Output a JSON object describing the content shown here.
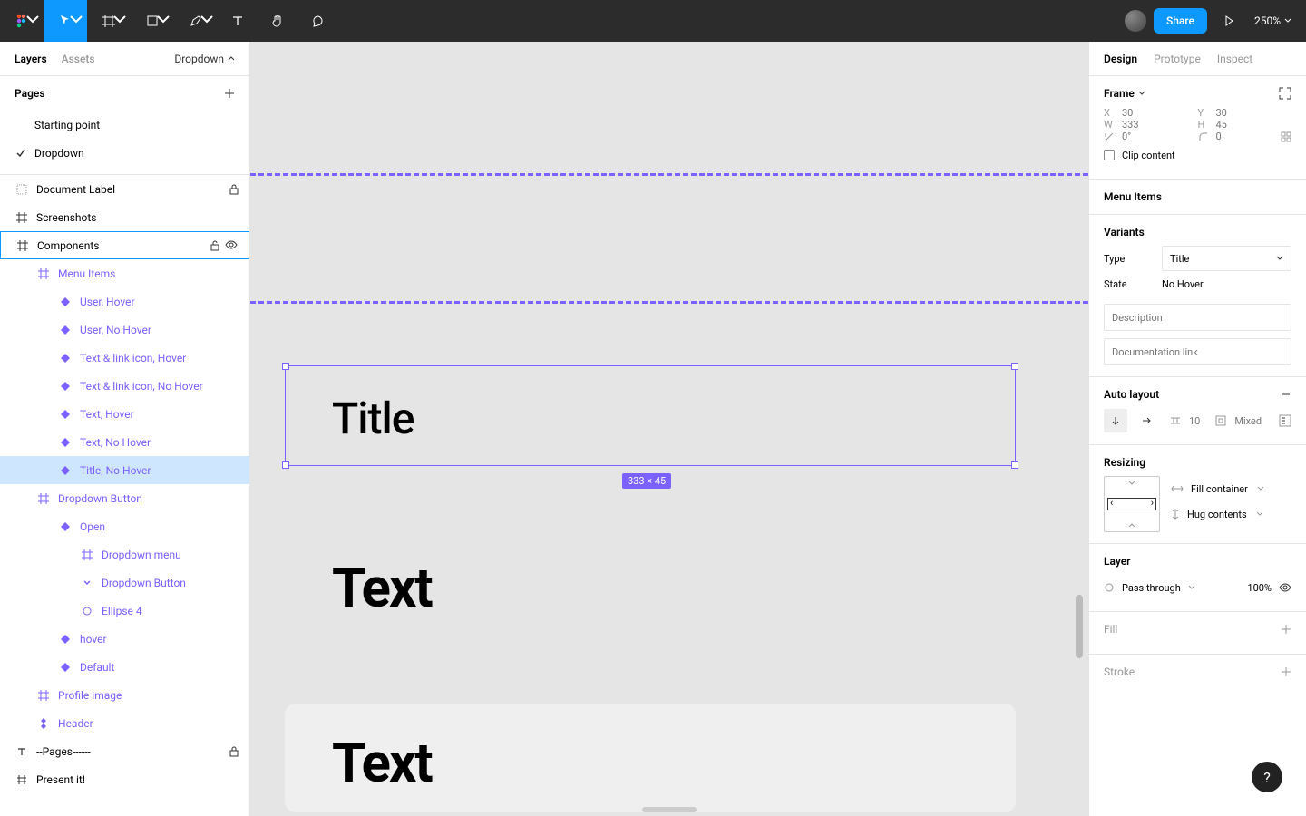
{
  "toolbar": {
    "share_label": "Share",
    "zoom": "250%"
  },
  "left_panel": {
    "tabs": {
      "layers": "Layers",
      "assets": "Assets"
    },
    "page_dropdown": "Dropdown",
    "pages_header": "Pages",
    "pages": [
      {
        "name": "Starting point",
        "current": false
      },
      {
        "name": "Dropdown",
        "current": true
      }
    ],
    "tree": [
      {
        "label": "Document Label",
        "indent": 0,
        "icon": "dotted-frame",
        "locked": true
      },
      {
        "label": "Screenshots",
        "indent": 0,
        "icon": "frame"
      },
      {
        "label": "Components",
        "indent": 0,
        "icon": "frame",
        "selected_parent": true,
        "unlocked": true,
        "visible": true
      },
      {
        "label": "Menu Items",
        "indent": 1,
        "icon": "frame",
        "comp": true
      },
      {
        "label": "User, Hover",
        "indent": 2,
        "icon": "diamond",
        "comp": true
      },
      {
        "label": "User, No Hover",
        "indent": 2,
        "icon": "diamond",
        "comp": true
      },
      {
        "label": "Text & link icon, Hover",
        "indent": 2,
        "icon": "diamond",
        "comp": true
      },
      {
        "label": "Text & link icon, No Hover",
        "indent": 2,
        "icon": "diamond",
        "comp": true
      },
      {
        "label": "Text, Hover",
        "indent": 2,
        "icon": "diamond",
        "comp": true
      },
      {
        "label": "Text, No Hover",
        "indent": 2,
        "icon": "diamond",
        "comp": true
      },
      {
        "label": "Title, No Hover",
        "indent": 2,
        "icon": "diamond",
        "comp": true,
        "selected": true
      },
      {
        "label": "Dropdown Button",
        "indent": 1,
        "icon": "frame",
        "comp": true
      },
      {
        "label": "Open",
        "indent": 2,
        "icon": "diamond",
        "comp": true
      },
      {
        "label": "Dropdown menu",
        "indent": 3,
        "icon": "frame",
        "comp": true
      },
      {
        "label": "Dropdown Button",
        "indent": 3,
        "icon": "chevron",
        "comp": true
      },
      {
        "label": "Ellipse 4",
        "indent": 3,
        "icon": "circle",
        "comp": true
      },
      {
        "label": "hover",
        "indent": 2,
        "icon": "diamond",
        "comp": true
      },
      {
        "label": "Default",
        "indent": 2,
        "icon": "diamond",
        "comp": true
      },
      {
        "label": "Profile image",
        "indent": 1,
        "icon": "frame",
        "comp": true
      },
      {
        "label": "Header",
        "indent": 1,
        "icon": "component-set",
        "comp": true
      },
      {
        "label": "--Pages------",
        "indent": 0,
        "icon": "text",
        "locked": true
      },
      {
        "label": "Present it!",
        "indent": 0,
        "icon": "hash"
      }
    ]
  },
  "canvas": {
    "title_text": "Title",
    "text_text": "Text",
    "text2_text": "Text",
    "dimensions_badge": "333 × 45"
  },
  "right_panel": {
    "tabs": {
      "design": "Design",
      "prototype": "Prototype",
      "inspect": "Inspect"
    },
    "frame_label": "Frame",
    "position": {
      "x_label": "X",
      "x": "30",
      "y_label": "Y",
      "y": "30"
    },
    "size": {
      "w_label": "W",
      "w": "333",
      "h_label": "H",
      "h": "45"
    },
    "rotation": {
      "deg": "0°",
      "corner": "0"
    },
    "clip_content": "Clip content",
    "menu_items_label": "Menu Items",
    "variants": {
      "header": "Variants",
      "type_label": "Type",
      "type_value": "Title",
      "state_label": "State",
      "state_value": "No Hover",
      "description_placeholder": "Description",
      "doclink_placeholder": "Documentation link"
    },
    "auto_layout": {
      "header": "Auto layout",
      "gap": "10",
      "padding": "Mixed"
    },
    "resizing": {
      "header": "Resizing",
      "horizontal": "Fill container",
      "vertical": "Hug contents"
    },
    "layer": {
      "header": "Layer",
      "blend": "Pass through",
      "opacity": "100%"
    },
    "fill_header": "Fill",
    "stroke_header": "Stroke"
  },
  "help_label": "?"
}
